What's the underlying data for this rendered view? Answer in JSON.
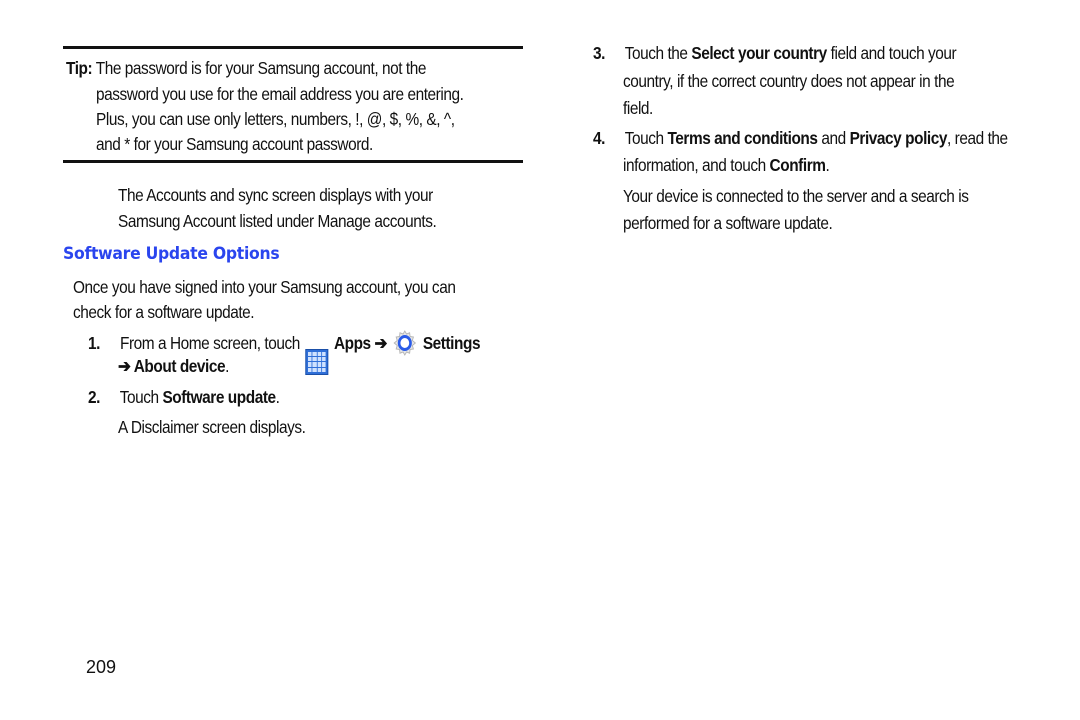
{
  "left_column": {
    "tip": {
      "label": "Tip:",
      "lines": [
        "The password is for your Samsung account, not the",
        "password you use for the email address you are entering.",
        "Plus, you can use only letters, numbers, !, @, $, %, &, ^,",
        "and * for your Samsung account password."
      ]
    },
    "accounts_text": [
      "The Accounts and sync screen displays with your",
      "Samsung Account listed under Manage accounts."
    ],
    "section_heading": "Software Update Options",
    "intro": [
      "Once you have signed into your Samsung account, you can",
      "check for a software update."
    ],
    "steps": [
      {
        "number": "1.",
        "pre": "From a Home screen, touch ",
        "apps_icon": "apps-grid-icon",
        "apps_label": "Apps ➔",
        "settings_icon": "settings-gear-icon",
        "settings_label": "Settings",
        "line2_arrow": "➔ About device",
        "line2_end": "."
      },
      {
        "number": "2.",
        "pre": "Touch ",
        "bold": "Software update",
        "end": ".",
        "note": "A Disclaimer screen displays."
      }
    ],
    "page_number": "209"
  },
  "right_column": {
    "steps": [
      {
        "number": "3.",
        "line1_pre": "Touch the ",
        "line1_bold": "Select your country",
        "line1_end": " field and touch your",
        "line2": "country, if the correct country does not appear in the",
        "line3": "field."
      },
      {
        "number": "4.",
        "line1_pre": "Touch ",
        "line1_bold1": "Terms and conditions",
        "line1_mid": " and ",
        "line1_bold2": "Privacy policy",
        "line1_end": ", read the",
        "line2_pre": "information, and touch ",
        "line2_bold": "Confirm",
        "line2_end": "."
      }
    ],
    "result": [
      "Your device is connected to the server and a search is",
      "performed for a software update."
    ]
  },
  "colors": {
    "heading": "#2a45ee",
    "text": "#111111",
    "apps_icon": "#2f6fd8"
  }
}
